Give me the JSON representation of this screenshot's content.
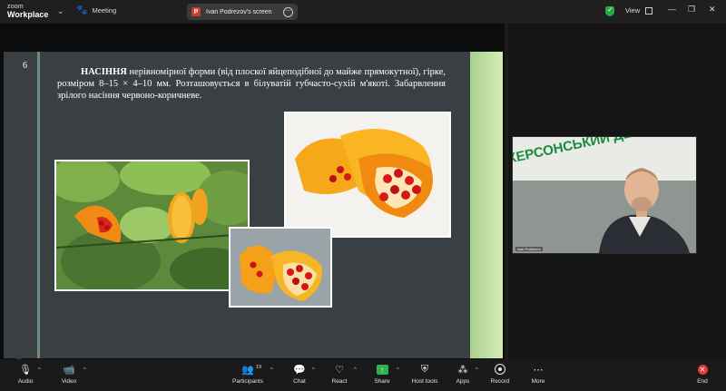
{
  "titlebar": {
    "brand_line1": "zoom",
    "brand_line2": "Workplace",
    "meeting_label": "Meeting",
    "share_pill_badge": "P",
    "share_pill_text": "Ivan Podrezov's screen",
    "view_label": "View"
  },
  "slide": {
    "number": "6",
    "text_bold": "НАСІННЯ",
    "text_rest": " нерівномірної форми (від плоскої яйцеподібної до майже прямокутної), гірке, розміром 8–15 × 4–10 мм. Розташовується в білуватій губчасто-сухій м'якоті. Забарвлення зрілого насіння червоно-коричневе."
  },
  "video": {
    "banner_text": "ХЕРСОНСЬКИЙ ДЕРЖАВНИЙ АГРАРНО-ЕКОНОМІЧНИЙ УНІВЕРСИТЕТ",
    "participant_label": "Ivan Podrezov"
  },
  "toolbar": {
    "audio": "Audio",
    "video": "Video",
    "participants": "Participants",
    "participants_count": "19",
    "chat": "Chat",
    "react": "React",
    "share": "Share",
    "host_tools": "Host tools",
    "apps": "Apps",
    "record": "Record",
    "more": "More",
    "end": "End"
  },
  "icons": [
    "zoom-logo",
    "paw-icon",
    "ellipsis-icon",
    "shield-icon",
    "grid-icon",
    "minimize-icon",
    "restore-icon",
    "close-icon",
    "pen-icon",
    "mic-icon",
    "camera-icon",
    "people-icon",
    "chat-bubble-icon",
    "heart-icon",
    "share-arrow-icon",
    "shield-star-icon",
    "apps-icon",
    "record-icon",
    "more-dots-icon",
    "end-x-icon"
  ],
  "colors": {
    "accent_green": "#2fb34f",
    "end_red": "#e33b3b",
    "slide_bg": "#3a3f44",
    "slide_stripe": "#a8d08f"
  }
}
